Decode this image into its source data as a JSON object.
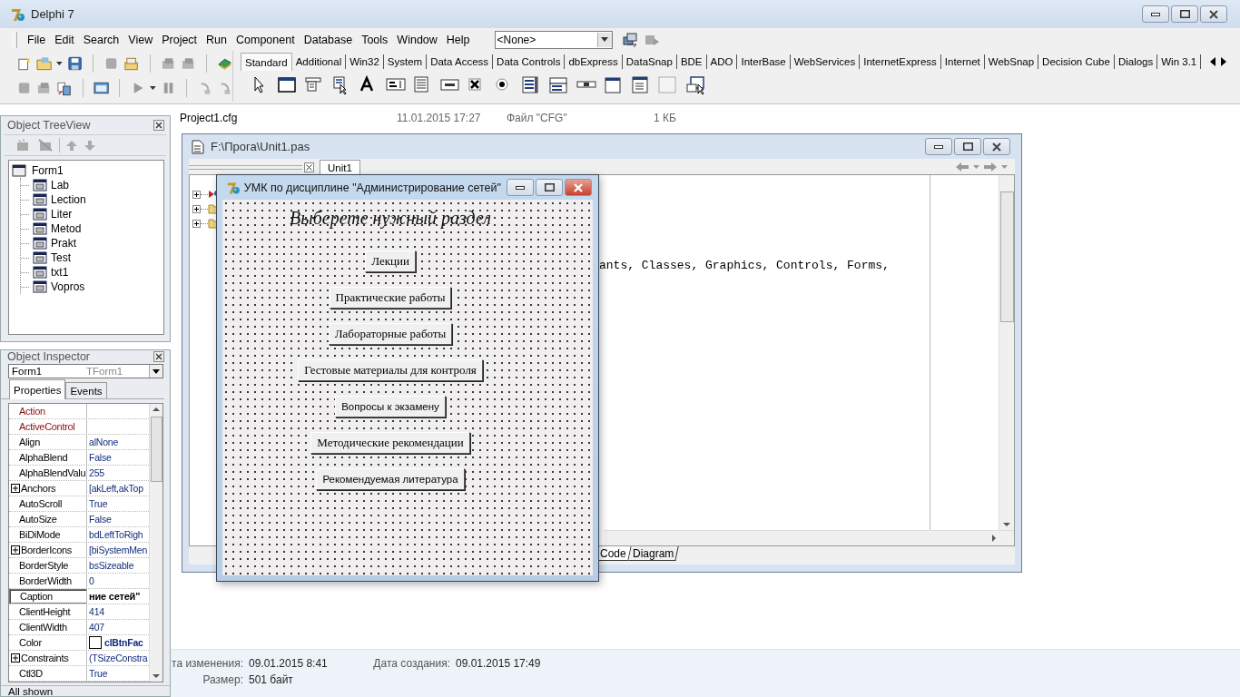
{
  "ide": {
    "title": "Delphi 7",
    "menu": [
      "File",
      "Edit",
      "Search",
      "View",
      "Project",
      "Run",
      "Component",
      "Database",
      "Tools",
      "Window",
      "Help"
    ],
    "component_combo": {
      "value": "<None>"
    },
    "palette_tabs": [
      {
        "label": "Standard",
        "selected": true
      },
      {
        "label": "Additional",
        "selected": false
      },
      {
        "label": "Win32",
        "selected": false
      },
      {
        "label": "System",
        "selected": false
      },
      {
        "label": "Data Access",
        "selected": false
      },
      {
        "label": "Data Controls",
        "selected": false
      },
      {
        "label": "dbExpress",
        "selected": false
      },
      {
        "label": "DataSnap",
        "selected": false
      },
      {
        "label": "BDE",
        "selected": false
      },
      {
        "label": "ADO",
        "selected": false
      },
      {
        "label": "InterBase",
        "selected": false
      },
      {
        "label": "WebServices",
        "selected": false
      },
      {
        "label": "InternetExpress",
        "selected": false
      },
      {
        "label": "Internet",
        "selected": false
      },
      {
        "label": "WebSnap",
        "selected": false
      },
      {
        "label": "Decision Cube",
        "selected": false
      },
      {
        "label": "Dialogs",
        "selected": false
      },
      {
        "label": "Win 3.1",
        "selected": false
      }
    ]
  },
  "explorer": {
    "file_row": {
      "name": "Project1.cfg",
      "date": "11.01.2015 17:27",
      "type": "Файл \"CFG\"",
      "size": "1 КБ"
    },
    "details": [
      {
        "label": "та изменения:",
        "value": "09.01.2015 8:41"
      },
      {
        "label": "Дата создания:",
        "value": "09.01.2015 17:49"
      },
      {
        "label": "Размер:",
        "value": "501 байт"
      }
    ]
  },
  "object_treeview": {
    "title": "Object TreeView",
    "root": {
      "label": "Form1",
      "children": [
        {
          "label": "Lab"
        },
        {
          "label": "Lection"
        },
        {
          "label": "Liter"
        },
        {
          "label": "Metod"
        },
        {
          "label": "Prakt"
        },
        {
          "label": "Test"
        },
        {
          "label": "txt1"
        },
        {
          "label": "Vopros"
        }
      ]
    }
  },
  "object_inspector": {
    "title": "Object Inspector",
    "object": "Form1",
    "object_type": "TForm1",
    "tabs": [
      {
        "label": "Properties",
        "selected": true
      },
      {
        "label": "Events",
        "selected": false
      }
    ],
    "properties": [
      {
        "name": "Action",
        "kind": "reference",
        "selected": false
      },
      {
        "name": "ActiveControl",
        "kind": "reference",
        "selected": false
      },
      {
        "name": "Align",
        "value": "alNone",
        "kind": "plain",
        "selected": false,
        "modified": false
      },
      {
        "name": "AlphaBlend",
        "value": "False",
        "kind": "plain",
        "selected": false,
        "modified": false
      },
      {
        "name": "AlphaBlendValu",
        "value": "255",
        "kind": "plain",
        "selected": false,
        "modified": false
      },
      {
        "name": "Anchors",
        "value": "[akLeft,akTop",
        "kind": "set",
        "selected": false,
        "modified": false
      },
      {
        "name": "AutoScroll",
        "value": "True",
        "kind": "plain",
        "selected": false,
        "modified": false
      },
      {
        "name": "AutoSize",
        "value": "False",
        "kind": "plain",
        "selected": false,
        "modified": false
      },
      {
        "name": "BiDiMode",
        "value": "bdLeftToRigh",
        "kind": "plain",
        "selected": false,
        "modified": false
      },
      {
        "name": "BorderIcons",
        "value": "[biSystemMen",
        "kind": "set",
        "selected": false,
        "modified": false
      },
      {
        "name": "BorderStyle",
        "value": "bsSizeable",
        "kind": "plain",
        "selected": false,
        "modified": false
      },
      {
        "name": "BorderWidth",
        "value": "0",
        "kind": "plain",
        "selected": false,
        "modified": false
      },
      {
        "name": "Caption",
        "value": "ние сетей\"",
        "kind": "plain",
        "selected": true,
        "modified": true
      },
      {
        "name": "ClientHeight",
        "value": "414",
        "kind": "plain",
        "selected": false,
        "modified": false
      },
      {
        "name": "ClientWidth",
        "value": "407",
        "kind": "plain",
        "selected": false,
        "modified": false
      },
      {
        "name": "Color",
        "value": "clBtnFac",
        "kind": "color",
        "color": "#ffffff",
        "selected": false,
        "modified": true
      },
      {
        "name": "Constraints",
        "value": "(TSizeConstra",
        "kind": "set",
        "selected": false,
        "modified": false
      },
      {
        "name": "Ctl3D",
        "value": "True",
        "kind": "plain",
        "selected": false,
        "modified": false
      }
    ],
    "status": "All shown"
  },
  "editor": {
    "title": "F:\\Прога\\Unit1.pas",
    "tabs": [
      {
        "label": "Unit1",
        "selected": true
      }
    ],
    "code_line": "ants, Classes, Graphics, Controls, Forms,",
    "view_tabs": [
      {
        "label": "Code",
        "selected": true
      },
      {
        "label": "Diagram",
        "selected": false
      }
    ]
  },
  "form": {
    "title": "УМК по дисциплине \"Администрирование сетей\"",
    "heading": "Выберете нужный раздел",
    "buttons": [
      {
        "label": "Лекции",
        "kind": "serif"
      },
      {
        "label": "Практические работы",
        "kind": "serif"
      },
      {
        "label": "Лабораторные работы",
        "kind": "serif"
      },
      {
        "label": "Гестовые материалы для контроля",
        "kind": "serif"
      },
      {
        "label": "Вопросы к экзамену",
        "kind": "sans"
      },
      {
        "label": "Методические рекомендации",
        "kind": "serif"
      },
      {
        "label": "Рекомендуемая литература",
        "kind": "sans"
      }
    ]
  }
}
